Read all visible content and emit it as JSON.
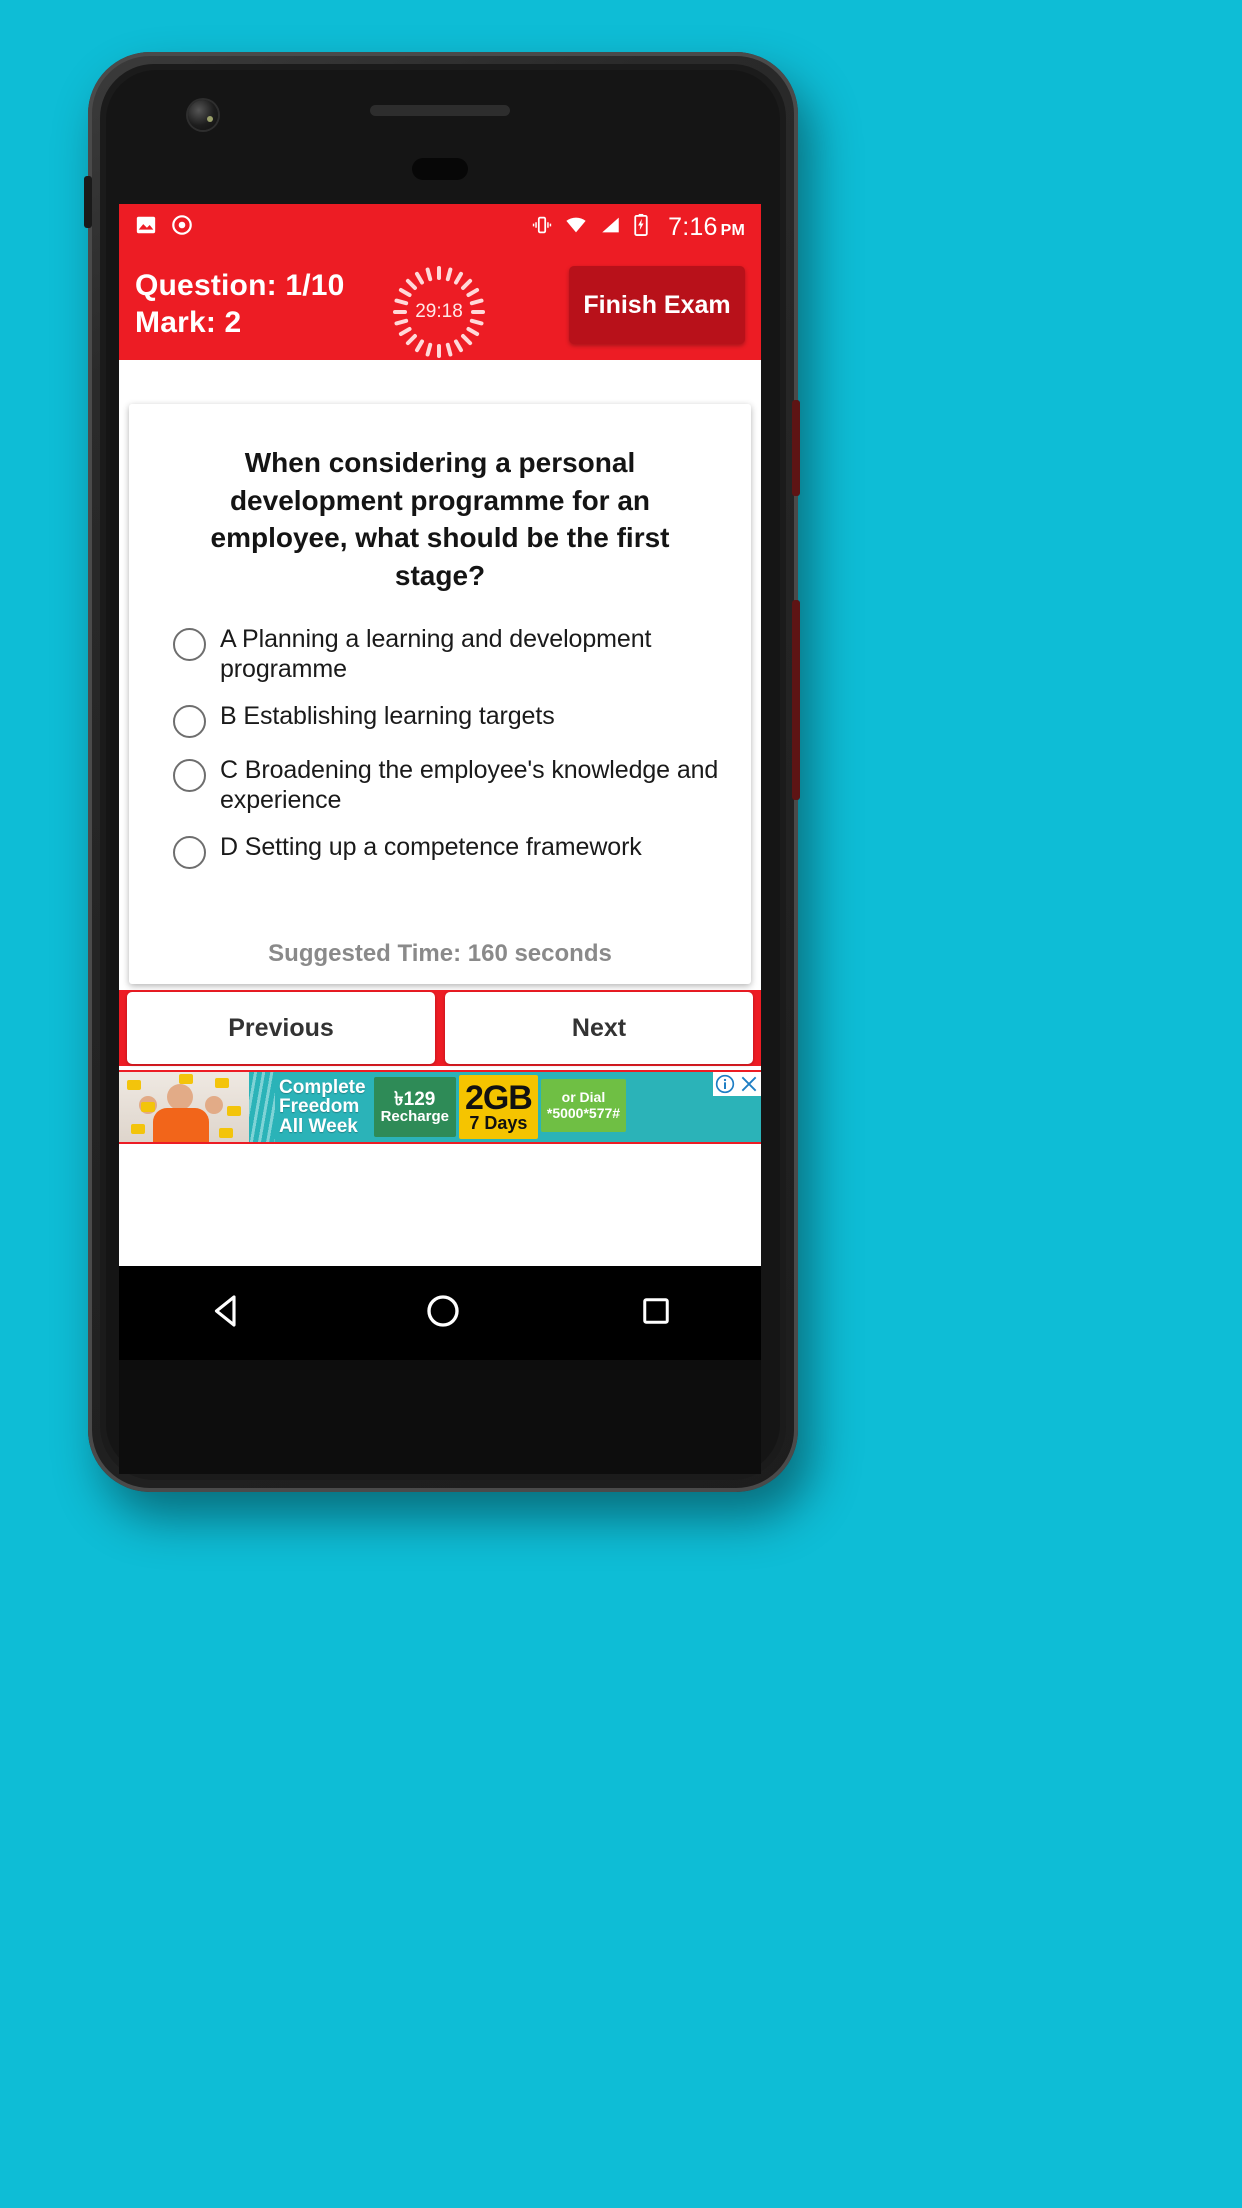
{
  "background_color": "#0EBDD6",
  "theme": {
    "primary_red": "#ED1C24",
    "dark_red": "#B8111A",
    "card_white": "#FFFFFF",
    "muted_gray": "#8A8A8A"
  },
  "status_bar": {
    "icons": [
      "image-icon",
      "record-icon"
    ],
    "right_icons": [
      "vibrate-icon",
      "wifi-icon",
      "signal-icon",
      "battery-charging-icon"
    ],
    "clock": "7:16",
    "meridiem": "PM"
  },
  "exam_header": {
    "question_counter": "Question: 1/10",
    "mark": "Mark: 2",
    "timer": "29:18",
    "finish_button": "Finish Exam"
  },
  "question": {
    "text": "When considering a personal development programme for an employee, what should be the first stage?",
    "options": [
      {
        "letter": "A",
        "text": "A Planning a learning and development programme",
        "selected": false
      },
      {
        "letter": "B",
        "text": "B Establishing learning targets",
        "selected": false
      },
      {
        "letter": "C",
        "text": "C Broadening the employee's knowledge and experience",
        "selected": false
      },
      {
        "letter": "D",
        "text": "D Setting up a competence framework",
        "selected": false
      }
    ],
    "suggested_time": "Suggested Time: 160 seconds"
  },
  "navigation": {
    "previous": "Previous",
    "next": "Next"
  },
  "ad": {
    "headline_line1": "Complete",
    "headline_line2": "Freedom",
    "headline_line3": "All Week",
    "recharge_price": "৳129",
    "recharge_label": "Recharge",
    "data_amount": "2GB",
    "data_validity": "7 Days",
    "dial_label": "or Dial",
    "dial_code": "*5000*577#",
    "info_icon": "info-icon",
    "close_icon": "close-icon"
  },
  "android_nav": {
    "back": "back-triangle-icon",
    "home": "home-circle-icon",
    "recents": "recents-square-icon"
  }
}
